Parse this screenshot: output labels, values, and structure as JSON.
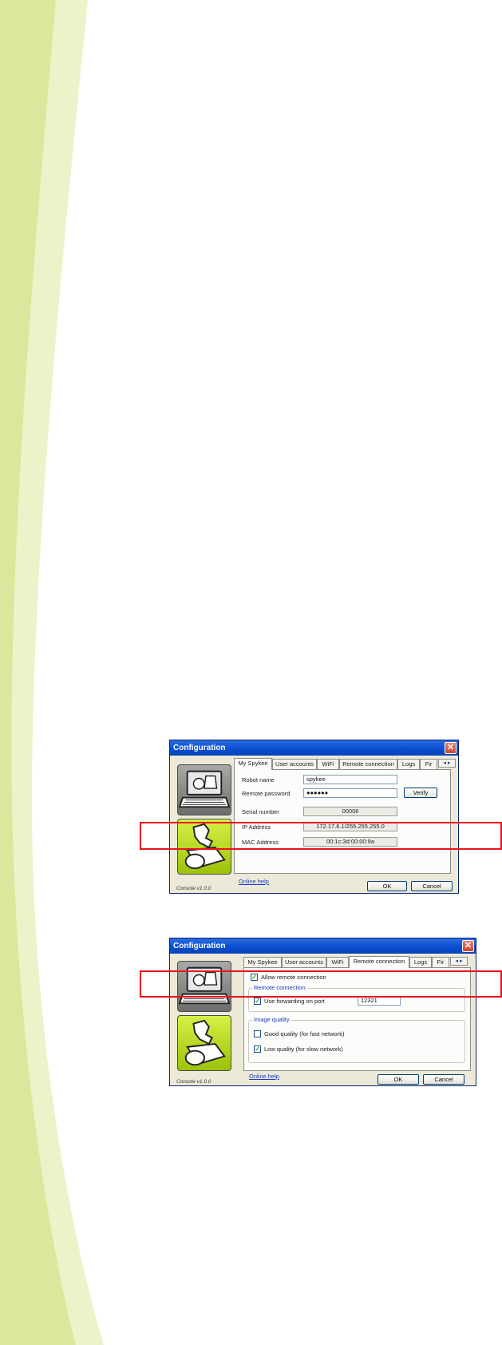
{
  "colors": {
    "highlight": "#e8141b",
    "titlebar": "#0a4fd1",
    "decor_light": "#eef2c8",
    "decor_mid": "#dce79e"
  },
  "window1": {
    "title": "Configuration",
    "tabs": [
      "My Spykee",
      "User accounts",
      "WiFi",
      "Remote connection",
      "Logs",
      "Fir"
    ],
    "active_tab": "My Spykee",
    "robot_name_label": "Robot name",
    "robot_name_value": "spykee",
    "remote_password_label": "Remote password",
    "remote_password_value": "●●●●●●",
    "verify_label": "Verify",
    "serial_label": "Serial number",
    "serial_value": "00006",
    "ip_label": "IP Address",
    "ip_value": "172.17.6.1/255.255.255.0",
    "mac_label": "MAC Address",
    "mac_value": "00:1c:3d:00:00:9a",
    "help_label": "Online help",
    "ok_label": "OK",
    "cancel_label": "Cancel",
    "version": "Console v1.0.0"
  },
  "window2": {
    "title": "Configuration",
    "tabs": [
      "My Spykee",
      "User accounts",
      "WiFi",
      "Remote connection",
      "Logs",
      "Fir"
    ],
    "active_tab": "Remote connection",
    "allow_remote_label": "Allow remote connection",
    "allow_remote_checked": true,
    "remote_group_title": "Remote connection",
    "forwarding_label": "Use forwarding on port",
    "forwarding_checked": true,
    "port_value": "12321",
    "image_group_title": "Image quality",
    "good_quality_label": "Good quality (for fast network)",
    "good_quality_checked": false,
    "low_quality_label": "Low quality (for slow network)",
    "low_quality_checked": true,
    "help_label": "Online help",
    "ok_label": "OK",
    "cancel_label": "Cancel",
    "version": "Console v1.0.0"
  },
  "icons": {
    "console": "laptop-robot-icon",
    "robot": "robot-icon",
    "close": "close-icon",
    "scroll_left": "chevron-left-icon",
    "scroll_right": "chevron-right-icon",
    "check": "checkmark-icon"
  }
}
